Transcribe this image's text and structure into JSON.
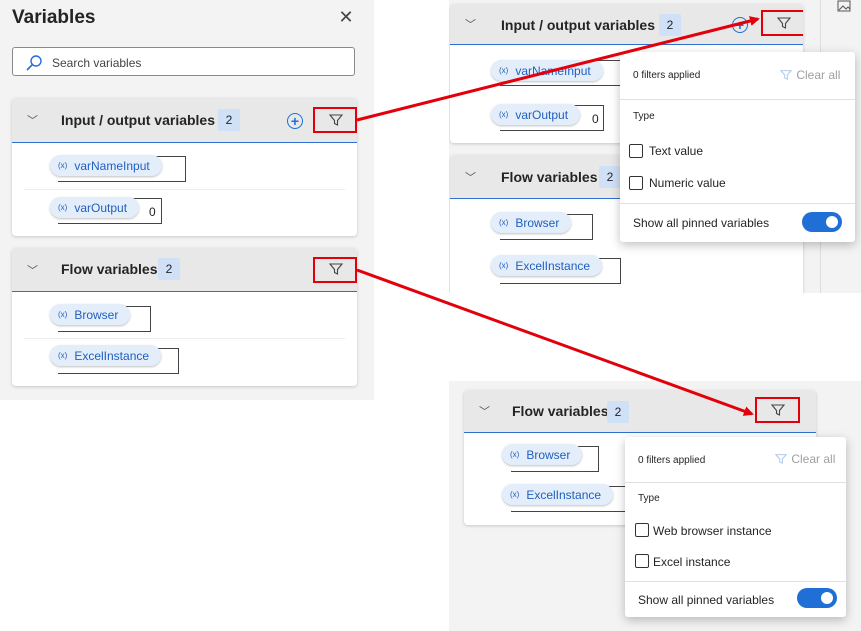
{
  "colors": {
    "accent": "#1f6fd6",
    "highlight": "#e3000b",
    "badge": "#cfe0f7"
  },
  "left": {
    "title": "Variables",
    "close_icon": "close-icon",
    "search_placeholder": "Search variables",
    "io": {
      "title": "Input / output variables",
      "count": "2",
      "vars": [
        {
          "name": "varNameInput",
          "value": ""
        },
        {
          "name": "varOutput",
          "value": "0"
        }
      ]
    },
    "flow": {
      "title": "Flow variables",
      "count": "2",
      "vars": [
        {
          "name": "Browser",
          "value": ""
        },
        {
          "name": "ExcelInstance",
          "value": ""
        }
      ]
    }
  },
  "top_right": {
    "io": {
      "title": "Input / output variables",
      "count": "2",
      "vars": [
        {
          "name": "varNameInput"
        },
        {
          "name": "varOutput",
          "value": "0"
        }
      ]
    },
    "flow": {
      "title": "Flow variables",
      "count": "2",
      "vars": [
        {
          "name": "Browser"
        },
        {
          "name": "ExcelInstance"
        }
      ]
    },
    "popup": {
      "filters_applied": "0 filters applied",
      "clear_all": "Clear all",
      "type_label": "Type",
      "options": [
        "Text value",
        "Numeric value"
      ],
      "show_pinned": "Show all pinned variables"
    }
  },
  "bottom_right": {
    "flow": {
      "title": "Flow variables",
      "count": "2",
      "vars": [
        {
          "name": "Browser"
        },
        {
          "name": "ExcelInstance"
        }
      ]
    },
    "popup": {
      "filters_applied": "0 filters applied",
      "clear_all": "Clear all",
      "type_label": "Type",
      "options": [
        "Web browser instance",
        "Excel instance"
      ],
      "show_pinned": "Show all pinned variables"
    }
  },
  "var_icon_label": "(x)"
}
